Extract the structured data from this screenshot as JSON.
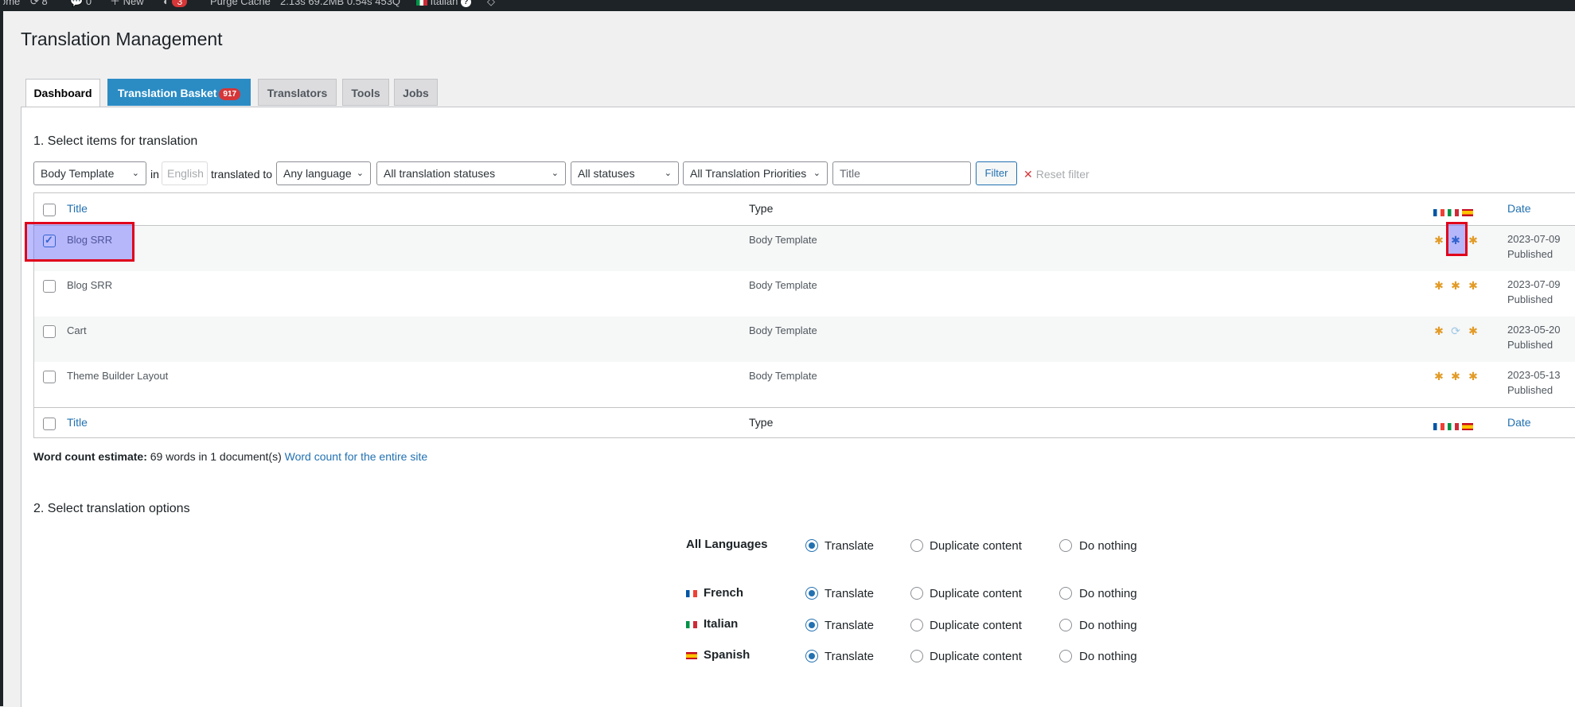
{
  "admin_bar": {
    "home_fragment": "ome",
    "updates_count": "8",
    "comments_count": "0",
    "new_label": "New",
    "notifications_count": "3",
    "purge_label": "Purge Cache",
    "stats": "2.13s  69.2MB  0.54s  453Q",
    "language_label": "Italian"
  },
  "page_title": "Translation Management",
  "tabs": [
    {
      "label": "Dashboard"
    },
    {
      "label": "Translation Basket",
      "count": "917"
    },
    {
      "label": "Translators"
    },
    {
      "label": "Tools"
    },
    {
      "label": "Jobs"
    }
  ],
  "section1_title": "1. Select items for translation",
  "filters": {
    "type_select": "Body Template",
    "in_label": "in",
    "source_language": "English",
    "translated_to_label": "translated to",
    "language_select": "Any language",
    "translation_status_select": "All translation statuses",
    "status_select": "All statuses",
    "priority_select": "All Translation Priorities",
    "title_placeholder": "Title",
    "filter_button": "Filter",
    "reset_label": "Reset filter"
  },
  "table": {
    "columns": {
      "title": "Title",
      "type": "Type",
      "date": "Date"
    },
    "language_flags": [
      "fr-flag-icon",
      "it-flag-icon",
      "es-flag-icon"
    ],
    "rows": [
      {
        "title": "Blog SRR",
        "type": "Body Template",
        "date": "2023-07-09",
        "status": "Published",
        "checked": true,
        "icons": [
          "add",
          "done",
          "add"
        ]
      },
      {
        "title": "Blog SRR",
        "type": "Body Template",
        "date": "2023-07-09",
        "status": "Published",
        "checked": false,
        "icons": [
          "add",
          "add",
          "add"
        ]
      },
      {
        "title": "Cart",
        "type": "Body Template",
        "date": "2023-05-20",
        "status": "Published",
        "checked": false,
        "icons": [
          "add",
          "sync",
          "add"
        ]
      },
      {
        "title": "Theme Builder Layout",
        "type": "Body Template",
        "date": "2023-05-13",
        "status": "Published",
        "checked": false,
        "icons": [
          "add",
          "add",
          "add"
        ]
      }
    ]
  },
  "word_count": {
    "label": "Word count estimate:",
    "value": "69 words in 1 document(s)",
    "link": "Word count for the entire site"
  },
  "section2_title": "2. Select translation options",
  "options": {
    "labels": {
      "translate": "Translate",
      "duplicate": "Duplicate content",
      "nothing": "Do nothing"
    },
    "rows": [
      {
        "name": "All Languages",
        "selected": "translate"
      },
      {
        "name": "French",
        "flag": "fr-flag-icon",
        "selected": "translate"
      },
      {
        "name": "Italian",
        "flag": "it-flag-icon",
        "selected": "translate"
      },
      {
        "name": "Spanish",
        "flag": "es-flag-icon",
        "selected": "translate"
      }
    ]
  },
  "colors": {
    "accent": "#2271b1",
    "basket": "#2b8cc4",
    "badge": "#d63638",
    "highlight": "#e0001b",
    "translate_icon": "#e29b27"
  }
}
